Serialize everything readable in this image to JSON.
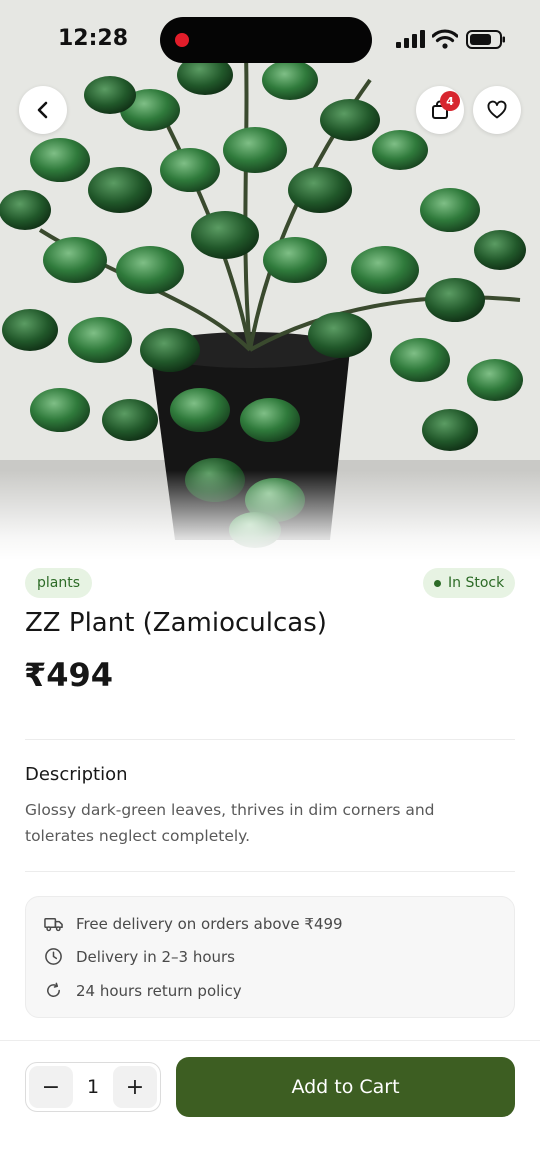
{
  "status_bar": {
    "time": "12:28"
  },
  "header": {
    "cart_count": "4"
  },
  "product": {
    "category": "plants",
    "stock_status": "In Stock",
    "name": "ZZ Plant (Zamioculcas)",
    "price": "₹494",
    "description_heading": "Description",
    "description": "Glossy dark-green leaves, thrives in dim corners and tolerates neglect completely."
  },
  "info": {
    "delivery_offer": "Free delivery on orders above ₹499",
    "delivery_time": "Delivery in 2–3 hours",
    "return_policy": "24 hours return policy"
  },
  "purchase": {
    "quantity": "1",
    "minus_label": "−",
    "plus_label": "+",
    "add_to_cart_label": "Add to Cart"
  },
  "icons": {
    "back": "chevron-left-icon",
    "cart": "shopping-bag-icon",
    "favorite": "heart-icon",
    "delivery": "truck-icon",
    "time": "clock-icon",
    "return": "refresh-icon"
  },
  "colors": {
    "accent": "#3d5e22",
    "tag_background": "#e7f3e3",
    "tag_text": "#2c6b26",
    "badge": "#d7262f"
  }
}
